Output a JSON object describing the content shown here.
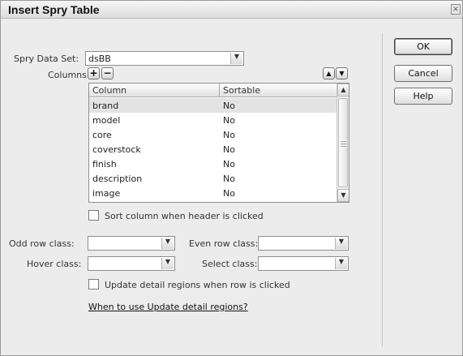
{
  "dialog": {
    "title": "Insert Spry Table",
    "close_icon": "×"
  },
  "dataset": {
    "label": "Spry Data Set:",
    "value": "dsBB"
  },
  "columns_label": "Columns:",
  "table": {
    "headers": {
      "column": "Column",
      "sortable": "Sortable"
    },
    "rows": [
      {
        "column": "brand",
        "sortable": "No"
      },
      {
        "column": "model",
        "sortable": "No"
      },
      {
        "column": "core",
        "sortable": "No"
      },
      {
        "column": "coverstock",
        "sortable": "No"
      },
      {
        "column": "finish",
        "sortable": "No"
      },
      {
        "column": "description",
        "sortable": "No"
      },
      {
        "column": "image",
        "sortable": "No"
      }
    ]
  },
  "sort_checkbox": {
    "label": "Sort column when header is clicked",
    "checked": false
  },
  "classes": {
    "odd": {
      "label": "Odd row class:",
      "value": ""
    },
    "even": {
      "label": "Even row class:",
      "value": ""
    },
    "hover": {
      "label": "Hover class:",
      "value": ""
    },
    "select": {
      "label": "Select class:",
      "value": ""
    }
  },
  "update_checkbox": {
    "label": "Update detail regions when row is clicked",
    "checked": false
  },
  "help_link": "When to use Update detail regions?",
  "buttons": {
    "ok": "OK",
    "cancel": "Cancel",
    "help": "Help"
  },
  "icons": {
    "add": "plus-icon",
    "remove": "minus-icon",
    "move_up": "triangle-up-icon",
    "move_down": "triangle-down-icon"
  }
}
